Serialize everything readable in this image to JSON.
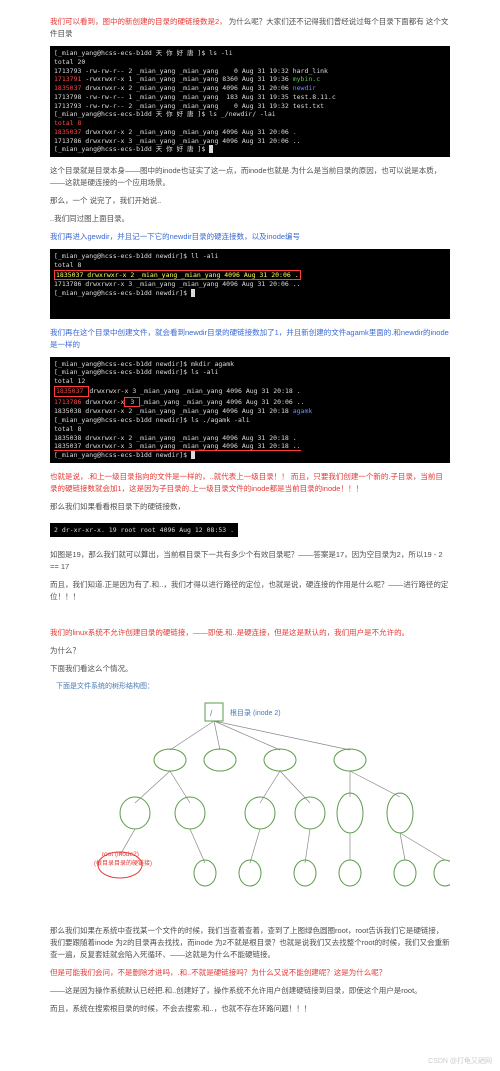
{
  "intro": {
    "l1a": "我们可以看到，图中的新创建的目录的硬链接数是2，",
    "l1b": "为什么呢？大家们还不记得我们曾经说过每个目录下面都有 这个文件目录"
  },
  "term1": {
    "prompt": "[_mian_yang@hcss-ecs-b1dd 天 你 好 唐 ]$",
    "cmd1": "ls -li",
    "total": "total 20",
    "r1": "1713793 -rw-rw-r-- 2 _mian_yang _mian_yang    0 Aug 31 19:32 hard_link",
    "r2a": "1713791 ",
    "r2b": "-rwxrwxr-x 1 _mian_yang _mian_yang 8360 Aug 31 19:36 ",
    "r2c": "mybin.c",
    "r3a": "1835037 ",
    "r3b": "drwxrwxr-x 2 _mian_yang _mian_yang 4096 Aug 31 20:06 ",
    "r3c": "newdir",
    "r4": "1713798 -rw-rw-r-- 1 _mian_yang _mian_yang  183 Aug 31 19:35 test.8.11.c",
    "r5": "1713793 -rw-rw-r-- 2 _mian_yang _mian_yang    0 Aug 31 19:32 test.txt",
    "cmd2": "ls _/newdir/ -lai",
    "total2": "total 8",
    "r6a": "1835037 ",
    "r6b": "drwxrwxr-x 2 _mian_yang _mian_yang 4096 Aug 31 20:06 ",
    "r6c": ".",
    "r7": "1713786 drwxrwxr-x 3 _mian_yang _mian_yang 4096 Aug 31 20:06 ..",
    "prompt2": "[_mian_yang@hcss-ecs-b1dd 天 你 好 唐 ]$ "
  },
  "para1": {
    "l1": "这个目录就是目录本身——图中的inode也证实了这一点，而inode也就是.为什么是当前目录的原因，也可以说是本质，——这就是硬连接的一个应用场景。",
    "l2": "那么，一个 说完了，我们开始说..",
    "l3": "..我们同过图上面目录。"
  },
  "blueTxt1": "我们再进入gewdir，并且记一下它的newdir目录的硬连接数，以及inode编号",
  "term2": {
    "prompt": "[_mian_yang@hcss-ecs-b1dd newdir]$",
    "cmd": "ll -ali",
    "total": "total 8",
    "hl": "1835037 drwxrwxr-x 2 _mian_yang _mian_yang 4096 Aug 31 20:06 .",
    "r1": "1713786 drwxrwxr-x 3 _mian_yang _mian_yang 4096 Aug 31 20:06 ..",
    "prompt2": "[_mian_yang@hcss-ecs-b1dd newdir]$ "
  },
  "blueTxt2": "我们再在这个目录中创建文件，就会看到newdir目录的硬链接数加了1，并且新创建的文件agamk里面的.和newdir的inode是一样的",
  "term3": {
    "p": "[_mian_yang@hcss-ecs-b1dd newdir]$",
    "c1": "mkdir agamk",
    "c2": "ls -ali",
    "t1": "total 12",
    "r1a": "1835037 ",
    "r1b": "drwxrwxr-x 3 _mian_yang _mian_yang 4096 Aug 31 20:18 .",
    "r2a": "1713786 ",
    "r2b": "drwxrwxr-x",
    "r2c": " 3 ",
    "r2d": "_mian_yang _mian_yang 4096 Aug 31 20:06 ..",
    "r3": "1835038 drwxrwxr-x 2 _mian_yang _mian_yang 4096 Aug 31 20:18 ",
    "r3b": "agamk",
    "c3": "ls ./agamk -ali",
    "t2": "total 8",
    "r4": "1835038 drwxrwxr-x 2 _mian_yang _mian_yang 4096 Aug 31 20:18 .",
    "r5": "1835037 drwxrwxr-x 3 _mian_yang _mian_yang 4096 Aug 31 20:18 ..",
    "p2": "[_mian_yang@hcss-ecs-b1dd newdir]$ "
  },
  "para2": {
    "l1": "也就是说，.和上一级目录指向的文件是一样的，..就代表上一级目录！！  而且，只要我们创建一个新的.子目录，当前目录的硬链接数就会加1，这是因为子目录的.上一级目录文件的inode都是当前目录的inode！！！",
    "l2": "那么我们如果看看根目录下的硬链接数，"
  },
  "single": "   2 dr-xr-xr-x.  19 root root  4096 Aug 12 08:53 .",
  "para3": {
    "l1": "如图是19，那么我们就可以算出，当前根目录下一共有多少个有效目录呢？——答案是17，因为空目录为2，所以19 - 2 == 17",
    "l2": "而且，我们知道.正是因为有了.和..，我们才得以进行路径的定位，也就是说，硬连接的作用是什么呢？——进行路径的定位！！！"
  },
  "para4": {
    "l1": "我们的linux系统不允许创建目录的硬链接，——即使.和..是硬连接，但是这是默认的，我们用户是不允许的。",
    "l2": "为什么？",
    "l3": "下面我们看这么个情况。"
  },
  "treeTitle": "下面是文件系统的树形结构图：",
  "tree": {
    "rootLabel": "根目录 (inode 2)",
    "slash": "/",
    "rootNode": "root (inode2)",
    "rootSub": "(根目录目录的硬链接)"
  },
  "para5": {
    "l1": "那么我们如果在系统中查找某一个文件的时候，我们当查着查着，查到了上图绿色圆圈root，root告诉我们它是硬链接，我们要跟随着inode 为2的目录再去找找，而inode 为2不就是根目录？也就是说我们又去找整个root的时候，我们又会重新查一遍，反复套娃就会陷入死循环、——这就是为什么不能硬链接。",
    "l2": "但是可能我们会问，不是删除才进吗，.和..不就是硬链接吗？为什么又说不能创建呢？这是为什么呢？",
    "l3": "——这是因为操作系统默认已经把.和..创建好了，操作系统不允许用户创建硬链接到目录，即使这个用户是root。",
    "l4": "而且，系统在搜索根目录的时候，不会去搜索.和..，也就不存在环路问题！！！"
  },
  "watermark": "CSDN @打龟又硒网"
}
